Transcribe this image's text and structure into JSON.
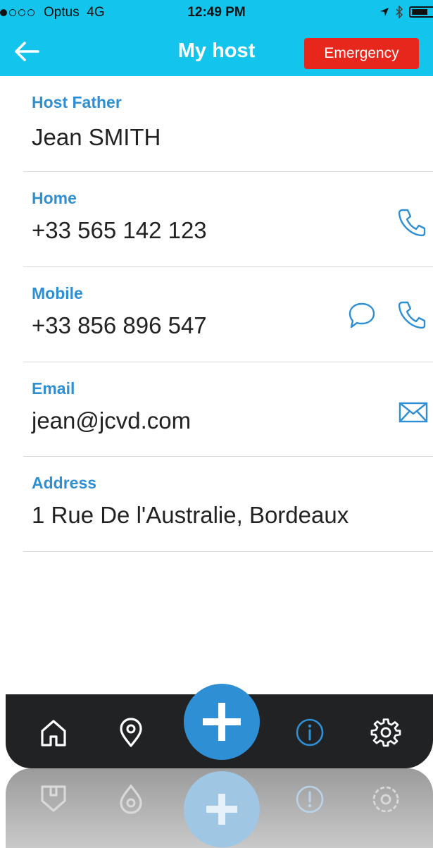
{
  "status_bar": {
    "carrier": "Optus",
    "network": "4G",
    "time": "12:49 PM"
  },
  "header": {
    "title": "My host",
    "emergency_label": "Emergency"
  },
  "contact": {
    "host_father_label": "Host Father",
    "host_father_value": "Jean SMITH",
    "home_label": "Home",
    "home_value": "+33 565 142 123",
    "mobile_label": "Mobile",
    "mobile_value": "+33 856 896 547",
    "email_label": "Email",
    "email_value": "jean@jcvd.com",
    "address_label": "Address",
    "address_value": "1 Rue De l'Australie, Bordeaux"
  },
  "tabbar": {
    "items": [
      "home-icon",
      "location-pin-icon",
      "add-icon",
      "info-icon",
      "gear-icon"
    ],
    "active": "info-icon"
  },
  "colors": {
    "header_bg": "#13c5ec",
    "accent": "#2f8fd4",
    "emergency": "#e8271c",
    "tabbar_bg": "#212224"
  }
}
